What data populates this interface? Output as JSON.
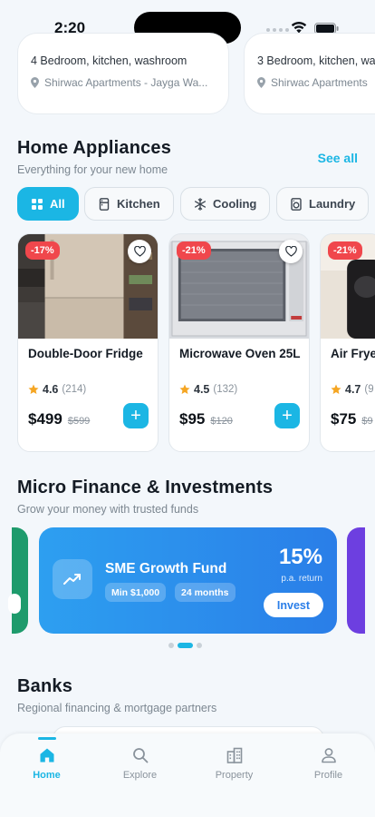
{
  "status_bar": {
    "time": "2:20"
  },
  "properties": [
    {
      "rooms": "4 Bedroom, kitchen, washroom",
      "location": "Shirwac Apartments  - Jayga Wa..."
    },
    {
      "rooms": "3 Bedroom, kitchen, wa",
      "location": "Shirwac Apartments"
    }
  ],
  "appliances": {
    "title": "Home Appliances",
    "subtitle": "Everything for your new home",
    "see_all": "See all",
    "chips": [
      {
        "label": "All",
        "icon": "grid-icon",
        "active": true
      },
      {
        "label": "Kitchen",
        "icon": "fridge-icon",
        "active": false
      },
      {
        "label": "Cooling",
        "icon": "snowflake-icon",
        "active": false
      },
      {
        "label": "Laundry",
        "icon": "washer-icon",
        "active": false
      }
    ],
    "products": [
      {
        "discount": "-17%",
        "name": "Double-Door Fridge",
        "rating": "4.6",
        "reviews": "(214)",
        "price": "$499",
        "old_price": "$599"
      },
      {
        "discount": "-21%",
        "name": "Microwave Oven 25L",
        "rating": "4.5",
        "reviews": "(132)",
        "price": "$95",
        "old_price": "$120"
      },
      {
        "discount": "-21%",
        "name": "Air Frye",
        "rating": "4.7",
        "reviews": "(9",
        "price": "$75",
        "old_price": "$9"
      }
    ]
  },
  "finance": {
    "title": "Micro Finance & Investments",
    "subtitle": "Grow your money with trusted funds",
    "fund": {
      "name": "SME Growth Fund",
      "min": "Min $1,000",
      "term": "24 months",
      "rate": "15%",
      "rate_label": "p.a. return",
      "cta": "Invest"
    }
  },
  "banks": {
    "title": "Banks",
    "subtitle": "Regional financing & mortgage partners"
  },
  "nav": {
    "home": "Home",
    "explore": "Explore",
    "property": "Property",
    "profile": "Profile"
  },
  "colors": {
    "accent": "#1bb6e4",
    "discount": "#f0474c",
    "fund": "#2a7ee8",
    "star": "#f5a623"
  }
}
